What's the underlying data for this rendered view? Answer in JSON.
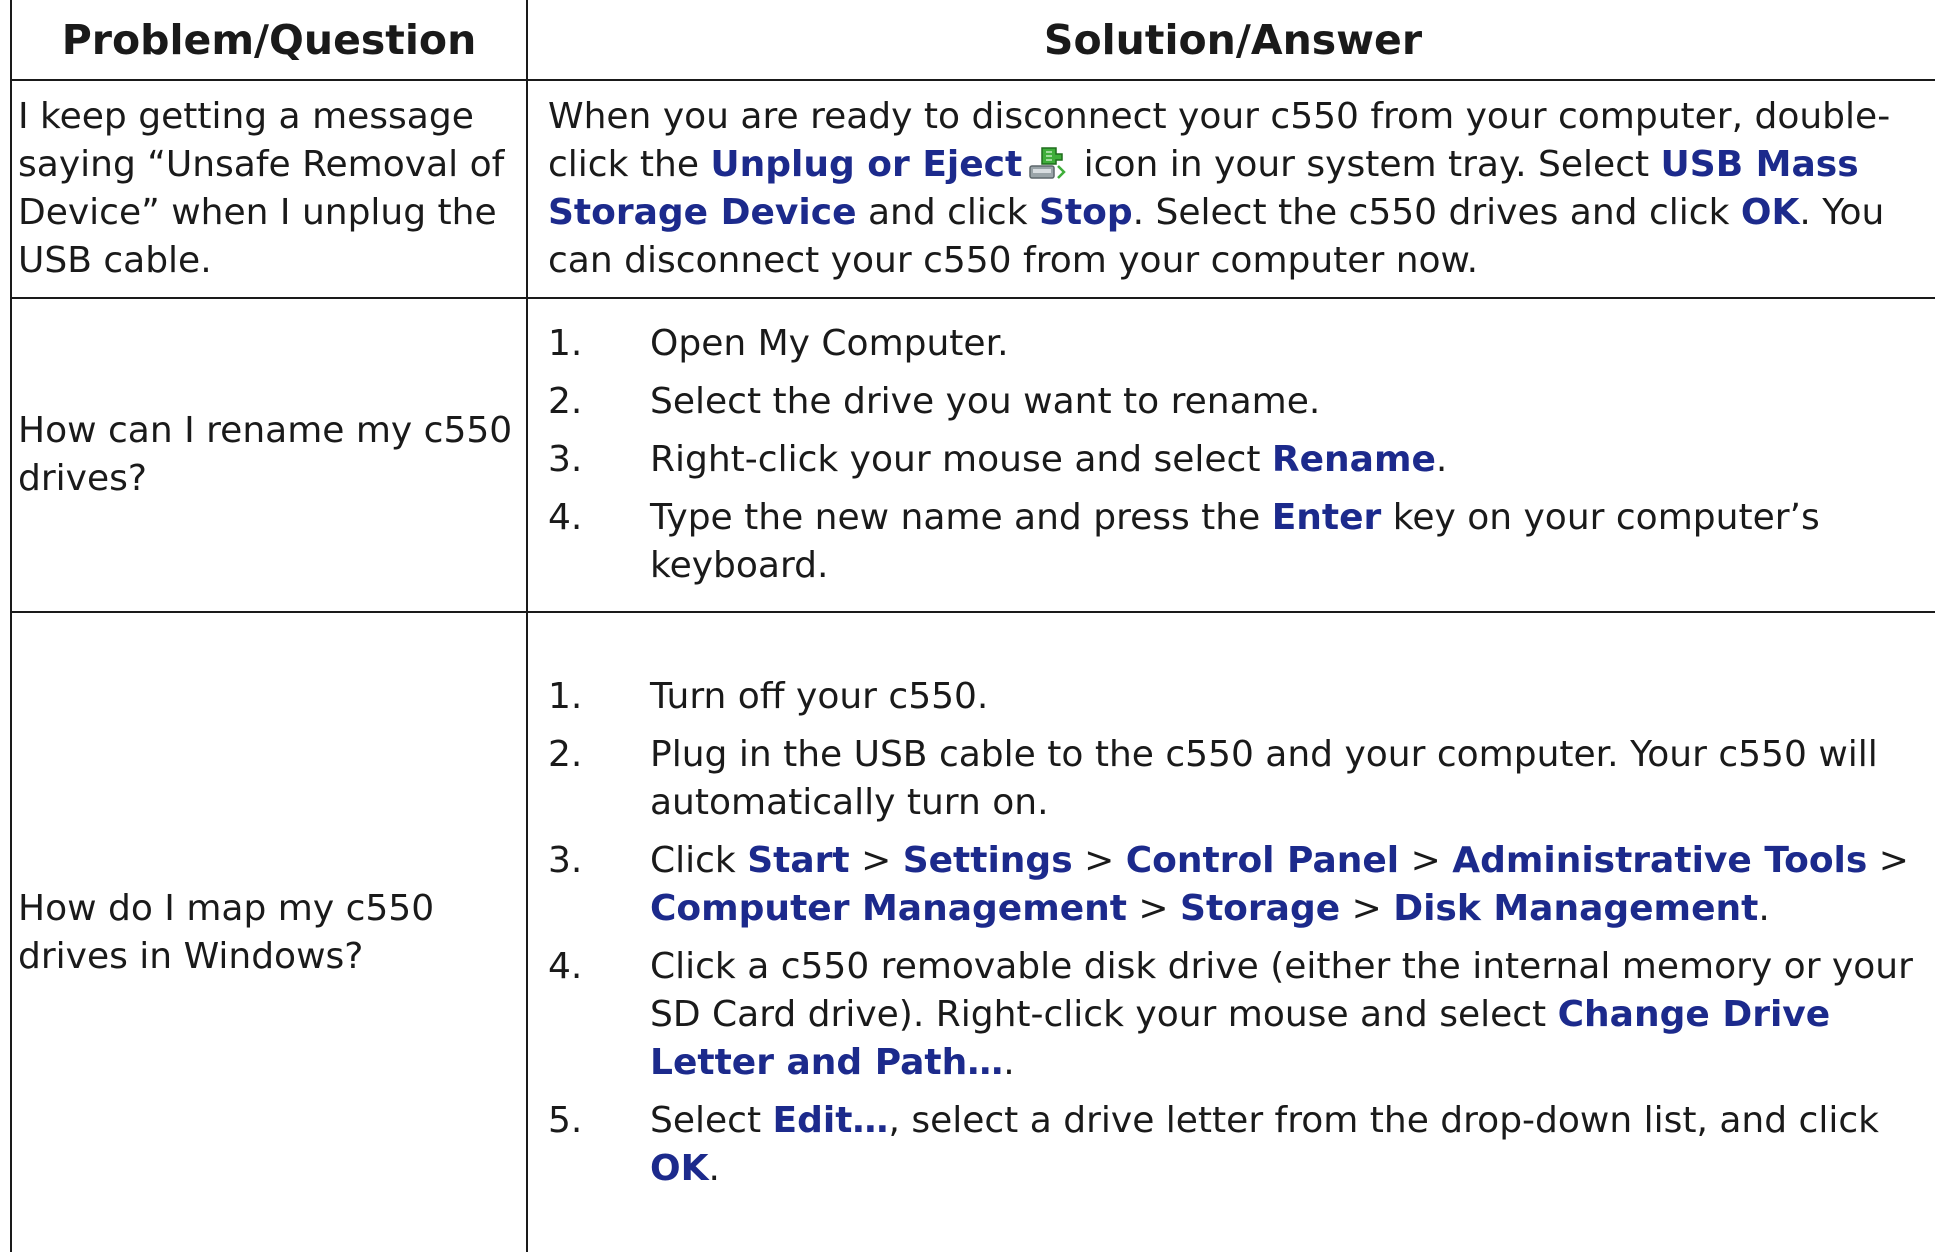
{
  "table": {
    "header": {
      "problem": "Problem/Question",
      "solution": "Solution/Answer"
    },
    "row1": {
      "question": "I keep getting a message saying “Unsafe Removal of Device” when I unplug the USB cable.",
      "answer": {
        "t1": "When you are ready to disconnect your c550 from your computer, double-click the ",
        "b1": "Unplug or Eject",
        "icon": "unplug-eject-icon",
        "t2": " icon in your system tray. Select ",
        "b2": "USB Mass Storage Device",
        "t3": " and click ",
        "b3": "Stop",
        "t4": ". Select the c550 drives and click ",
        "b4": "OK",
        "t5": ". You can disconnect your c550 from your computer now."
      }
    },
    "row2": {
      "question": "How can I rename my c550 drives?",
      "steps": [
        {
          "num": "1.",
          "text": "Open My Computer."
        },
        {
          "num": "2.",
          "text": "Select the drive you want to rename."
        },
        {
          "num": "3.",
          "t1": "Right-click your mouse and select ",
          "b1": "Rename",
          "t2": "."
        },
        {
          "num": "4.",
          "t1": "Type the new name and press the ",
          "b1": "Enter",
          "t2": " key on your computer’s keyboard."
        }
      ]
    },
    "row3": {
      "question": "How do I map my c550 drives in Windows?",
      "steps": [
        {
          "num": "1.",
          "text": "Turn off your c550."
        },
        {
          "num": "2.",
          "text": "Plug in the USB cable to the c550 and your computer. Your c550 will automatically turn on."
        },
        {
          "num": "3.",
          "t1": "Click ",
          "b1": "Start",
          "t2": " > ",
          "b2": "Settings",
          "t3": " > ",
          "b3": "Control Panel",
          "t4": " > ",
          "b4": "Administrative Tools",
          "t5": " > ",
          "b5": "Computer Management",
          "t6": " > ",
          "b6": "Storage",
          "t7": " > ",
          "b7": "Disk Management",
          "t8": "."
        },
        {
          "num": "4.",
          "t1": "Click a c550 removable disk drive (either the internal memory or your SD Card drive). Right-click your mouse and select ",
          "b1": "Change Drive Letter and Path…",
          "t2": "."
        },
        {
          "num": "5.",
          "t1": "Select ",
          "b1": "Edit…",
          "t2": ", select a drive letter from the drop-down list, and click ",
          "b2": "OK",
          "t3": "."
        }
      ]
    }
  },
  "colors": {
    "bold_text": "#1c2a8c",
    "border": "#1a1a1a",
    "text": "#1a1a1a"
  }
}
